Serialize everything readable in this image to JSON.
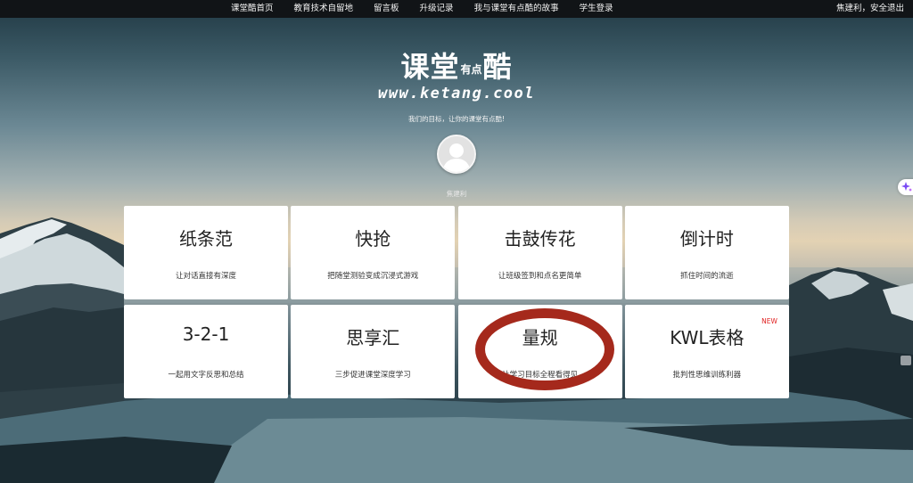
{
  "nav": {
    "links": [
      {
        "label": "课堂酷首页"
      },
      {
        "label": "教育技术自留地"
      },
      {
        "label": "留言板"
      },
      {
        "label": "升级记录"
      },
      {
        "label": "我与课堂有点酷的故事"
      },
      {
        "label": "学生登录"
      }
    ],
    "user_name": "焦建利",
    "logout_prefix": "，",
    "logout_label": "安全退出"
  },
  "header": {
    "logo_part1": "课堂",
    "logo_small": "有点",
    "logo_part2": "酷",
    "url": "www.ketang.cool",
    "slogan": "我们的目标，让你的课堂有点酷!",
    "username": "焦建利"
  },
  "cards": [
    {
      "title": "纸条范",
      "desc": "让对话直接有深度"
    },
    {
      "title": "快抢",
      "desc": "把随堂测验变成沉浸式游戏"
    },
    {
      "title": "击鼓传花",
      "desc": "让班级签到和点名更简单"
    },
    {
      "title": "倒计时",
      "desc": "抓住时间的流逝"
    },
    {
      "title": "3-2-1",
      "desc": "一起用文字反思和总结"
    },
    {
      "title": "思享汇",
      "desc": "三步促进课堂深度学习"
    },
    {
      "title": "量规",
      "desc": "让学习目标全程看得见"
    },
    {
      "title": "KWL表格",
      "desc": "批判性思维训练利器",
      "badge": "NEW"
    }
  ],
  "colors": {
    "nav_bg": "#111417",
    "highlight_ring": "#a5291c",
    "badge": "#e02020",
    "card_bg": "#ffffff"
  },
  "icons": {
    "avatar": "default-user-silhouette",
    "ai_widget": "sparkle-icon"
  }
}
